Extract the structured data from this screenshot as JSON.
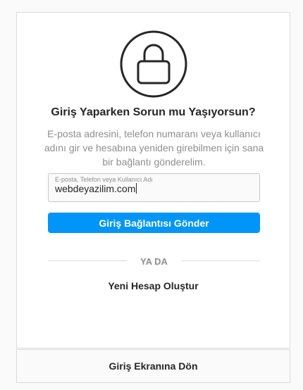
{
  "card": {
    "title": "Giriş Yaparken Sorun mu Yaşıyorsun?",
    "description": "E-posta adresini, telefon numaranı veya kullanıcı adını gir ve hesabına yeniden girebilmen için sana bir bağlantı gönderelim.",
    "input": {
      "label": "E-posta, Telefon veya Kullanıcı Adı",
      "value": "webdeyazilim.com"
    },
    "send_button": "Giriş Bağlantısı Gönder",
    "divider_text": "YA DA",
    "create_account_link": "Yeni Hesap Oluştur"
  },
  "footer": {
    "back_link": "Giriş Ekranına Dön"
  },
  "icons": {
    "lock": "lock-icon"
  },
  "colors": {
    "primary_button": "#0095f6",
    "text_primary": "#262626",
    "text_secondary": "#8e8e8e",
    "border": "#dbdbdb",
    "background": "#fafafa"
  }
}
